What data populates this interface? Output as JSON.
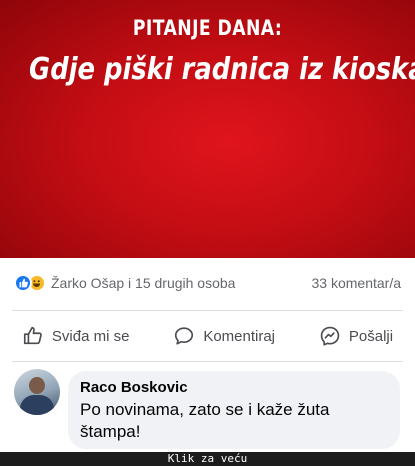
{
  "post": {
    "image_label": "PITANJE DANA:",
    "image_title": "Gdje piški radnica iz kioska?",
    "image_bg_color": "#d4101a"
  },
  "reactions": {
    "icons": [
      "like-icon",
      "haha-icon"
    ],
    "summary": "Žarko Ošap i 15 drugih osoba",
    "comments_count": "33 komentar/a"
  },
  "actions": {
    "like_label": "Sviđa mi se",
    "comment_label": "Komentiraj",
    "share_label": "Pošalji"
  },
  "comment": {
    "author": "Raco Boskovic",
    "text": "Po novinama, zato se i kaže žuta štampa!"
  },
  "footer": {
    "text": "Klik za veću"
  },
  "colors": {
    "accent": "#1877f2",
    "bubble": "#f0f2f5"
  }
}
